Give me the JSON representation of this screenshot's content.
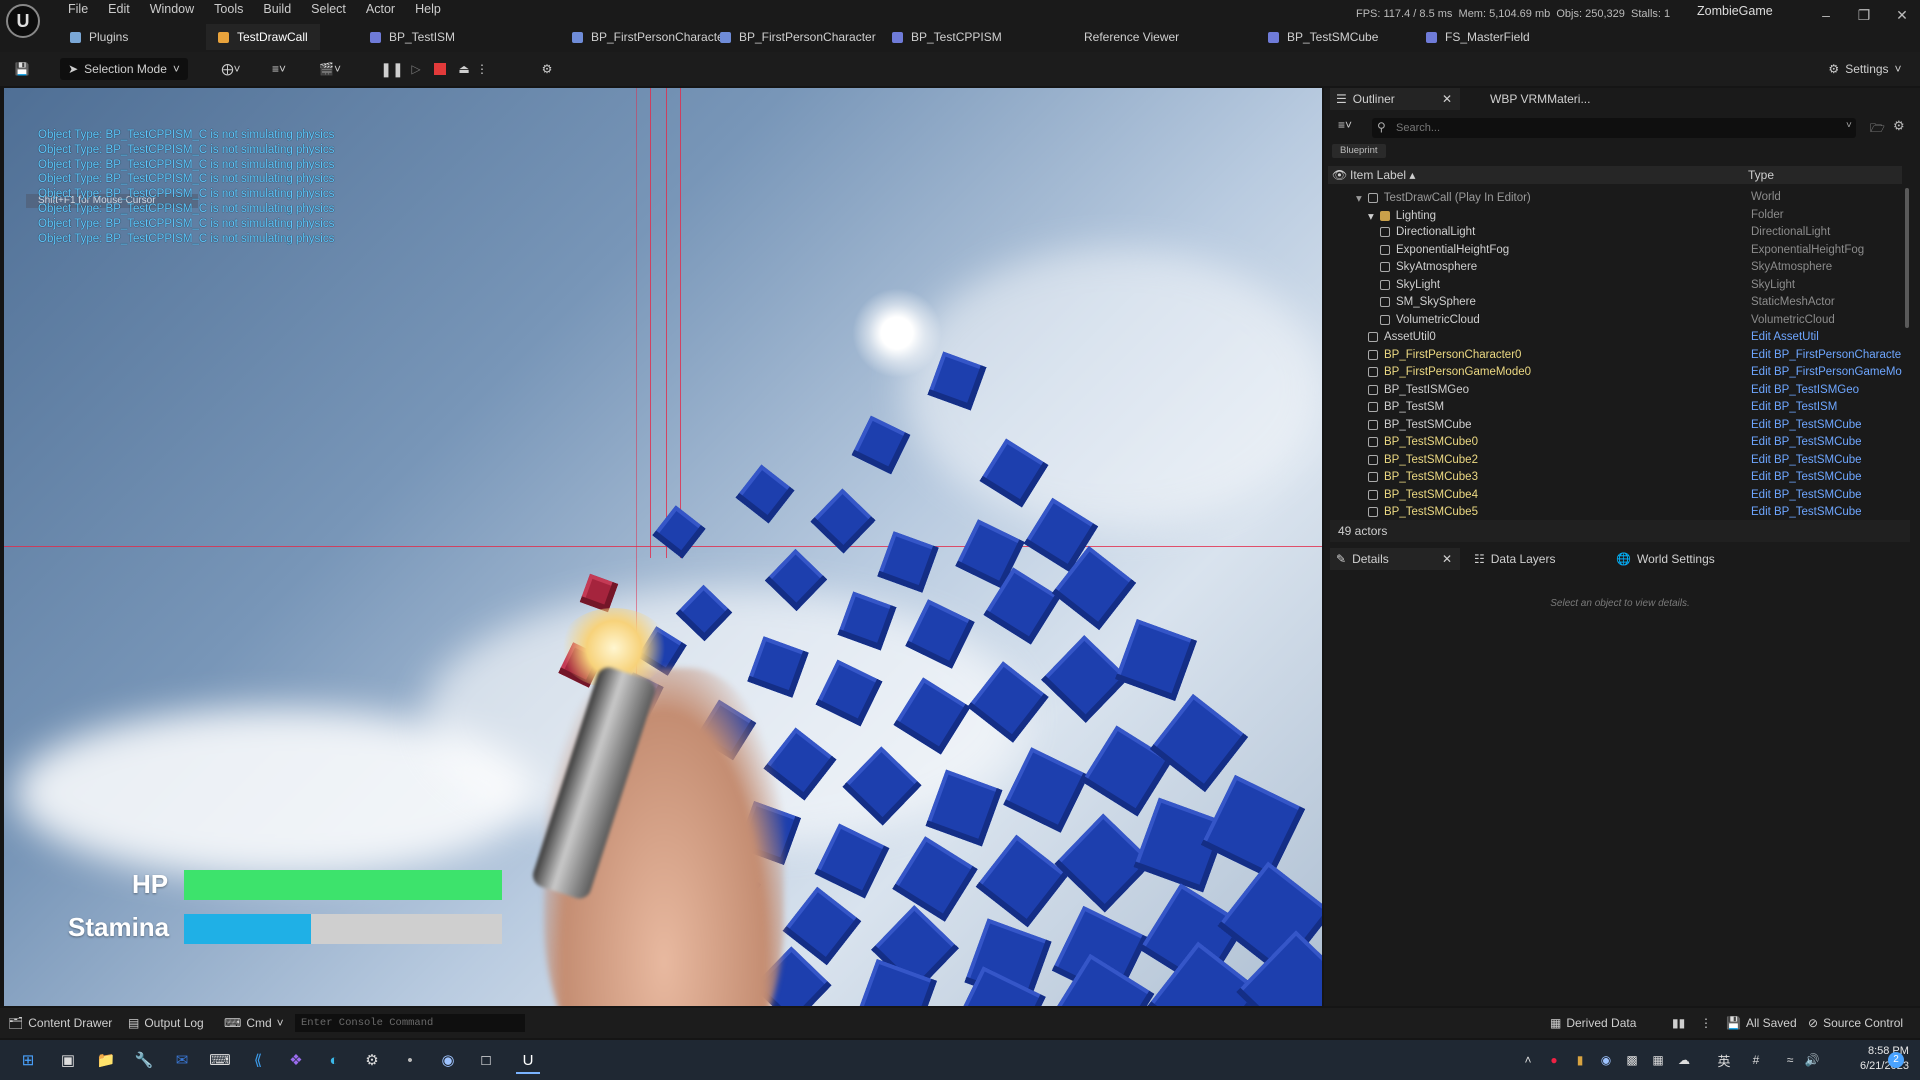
{
  "menu": [
    "File",
    "Edit",
    "Window",
    "Tools",
    "Build",
    "Select",
    "Actor",
    "Help"
  ],
  "stats": {
    "fps": "FPS: 117.4",
    "ms": "/ 8.5 ms",
    "mem": "Mem: 5,104.69 mb",
    "objs": "Objs: 250,329",
    "stalls": "Stalls: 1"
  },
  "project_name": "ZombieGame",
  "tabs": [
    {
      "label": "Plugins"
    },
    {
      "label": "TestDrawCall"
    },
    {
      "label": "BP_TestISM"
    },
    {
      "label": "BP_FirstPersonCharacter"
    },
    {
      "label": "BP_FirstPersonCharacter"
    },
    {
      "label": "BP_TestCPPISM"
    },
    {
      "label": "Reference Viewer"
    },
    {
      "label": "BP_TestSMCube"
    },
    {
      "label": "FS_MasterField"
    }
  ],
  "toolbar": {
    "selection_mode": "Selection Mode",
    "settings": "Settings"
  },
  "viewport": {
    "hint": "Shift+F1 for Mouse Cursor",
    "log_lines": [
      "Object Type: BP_TestCPPISM_C is not simulating physics",
      "Object Type: BP_TestCPPISM_C is not simulating physics",
      "Object Type: BP_TestCPPISM_C is not simulating physics",
      "Object Type: BP_TestCPPISM_C is not simulating physics",
      "Object Type: BP_TestCPPISM_C is not simulating physics",
      "Object Type: BP_TestCPPISM_C is not simulating physics",
      "Object Type: BP_TestCPPISM_C is not simulating physics",
      "Object Type: BP_TestCPPISM_C is not simulating physics"
    ],
    "hud": {
      "hp_label": "HP",
      "stamina_label": "Stamina",
      "hp_fraction": 1.0,
      "stamina_fraction": 0.4,
      "hp_color": "#3de36c",
      "stamina_color": "#1fb0e6"
    }
  },
  "outliner": {
    "tab_label": "Outliner",
    "other_tab": "WBP VRMMateri...",
    "search_placeholder": "Search...",
    "filter_chip": "Blueprint",
    "col_label": "Item Label",
    "col_type": "Type",
    "rows": [
      {
        "label": "TestDrawCall (Play In Editor)",
        "type": "World",
        "indent": 0,
        "style": "dim",
        "link": false
      },
      {
        "label": "Lighting",
        "type": "Folder",
        "indent": 1,
        "style": "normal",
        "link": false
      },
      {
        "label": "DirectionalLight",
        "type": "DirectionalLight",
        "indent": 2,
        "style": "normal",
        "link": false
      },
      {
        "label": "ExponentialHeightFog",
        "type": "ExponentialHeightFog",
        "indent": 2,
        "style": "normal",
        "link": false
      },
      {
        "label": "SkyAtmosphere",
        "type": "SkyAtmosphere",
        "indent": 2,
        "style": "normal",
        "link": false
      },
      {
        "label": "SkyLight",
        "type": "SkyLight",
        "indent": 2,
        "style": "normal",
        "link": false
      },
      {
        "label": "SM_SkySphere",
        "type": "StaticMeshActor",
        "indent": 2,
        "style": "normal",
        "link": false
      },
      {
        "label": "VolumetricCloud",
        "type": "VolumetricCloud",
        "indent": 2,
        "style": "normal",
        "link": false
      },
      {
        "label": "AssetUtil0",
        "type": "Edit AssetUtil",
        "indent": 1,
        "style": "normal",
        "link": true
      },
      {
        "label": "BP_FirstPersonCharacter0",
        "type": "Edit BP_FirstPersonCharacte",
        "indent": 1,
        "style": "yellow",
        "link": true
      },
      {
        "label": "BP_FirstPersonGameMode0",
        "type": "Edit BP_FirstPersonGameMo",
        "indent": 1,
        "style": "yellow",
        "link": true
      },
      {
        "label": "BP_TestISMGeo",
        "type": "Edit BP_TestISMGeo",
        "indent": 1,
        "style": "normal",
        "link": true
      },
      {
        "label": "BP_TestSM",
        "type": "Edit BP_TestISM",
        "indent": 1,
        "style": "normal",
        "link": true
      },
      {
        "label": "BP_TestSMCube",
        "type": "Edit BP_TestSMCube",
        "indent": 1,
        "style": "normal",
        "link": true
      },
      {
        "label": "BP_TestSMCube0",
        "type": "Edit BP_TestSMCube",
        "indent": 1,
        "style": "yellow",
        "link": true
      },
      {
        "label": "BP_TestSMCube2",
        "type": "Edit BP_TestSMCube",
        "indent": 1,
        "style": "yellow",
        "link": true
      },
      {
        "label": "BP_TestSMCube3",
        "type": "Edit BP_TestSMCube",
        "indent": 1,
        "style": "yellow",
        "link": true
      },
      {
        "label": "BP_TestSMCube4",
        "type": "Edit BP_TestSMCube",
        "indent": 1,
        "style": "yellow",
        "link": true
      },
      {
        "label": "BP_TestSMCube5",
        "type": "Edit BP_TestSMCube",
        "indent": 1,
        "style": "yellow",
        "link": true
      }
    ],
    "actor_count": "49 actors"
  },
  "details": {
    "tab_label": "Details",
    "data_layers": "Data Layers",
    "world_settings": "World Settings",
    "empty_text": "Select an object to view details."
  },
  "statusbar": {
    "content_drawer": "Content Drawer",
    "output_log": "Output Log",
    "cmd": "Cmd",
    "console_placeholder": "Enter Console Command",
    "derived_data": "Derived Data",
    "all_saved": "All Saved",
    "source_control": "Source Control"
  },
  "taskbar": {
    "time": "8:58 PM",
    "date": "6/21/2023",
    "ime": "英",
    "notif_count": "2"
  }
}
